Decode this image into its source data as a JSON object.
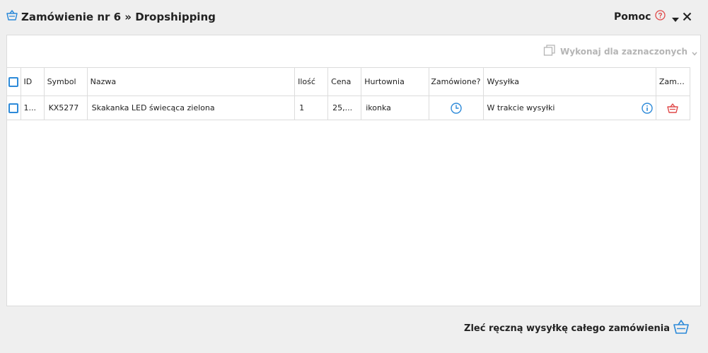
{
  "header": {
    "title": "Zamówienie nr 6 » Dropshipping",
    "help_label": "Pomoc"
  },
  "toolbar": {
    "bulk_action_label": "Wykonaj dla zaznaczonych"
  },
  "table": {
    "columns": {
      "id": "ID",
      "symbol": "Symbol",
      "nazwa": "Nazwa",
      "ilosc": "Ilość",
      "cena": "Cena",
      "hurtownia": "Hurtownia",
      "zamowione": "Zamówione?",
      "wysylka": "Wysyłka",
      "zamow": "Zamów"
    },
    "rows": [
      {
        "id": "1...",
        "symbol": "KX5277",
        "nazwa": "Skakanka LED świecąca zielona",
        "ilosc": "1",
        "cena": "25,...",
        "hurtownia": "ikonka",
        "zamowione_icon": "clock-icon",
        "wysylka": "W trakcie wysyłki",
        "zamow_icon": "basket-icon"
      }
    ]
  },
  "footer": {
    "manual_shipping_label": "Zleć ręczną wysyłkę całego zamówienia"
  },
  "colors": {
    "accent": "#2d8ad9",
    "danger": "#e04848",
    "muted": "#b5b5b5"
  }
}
